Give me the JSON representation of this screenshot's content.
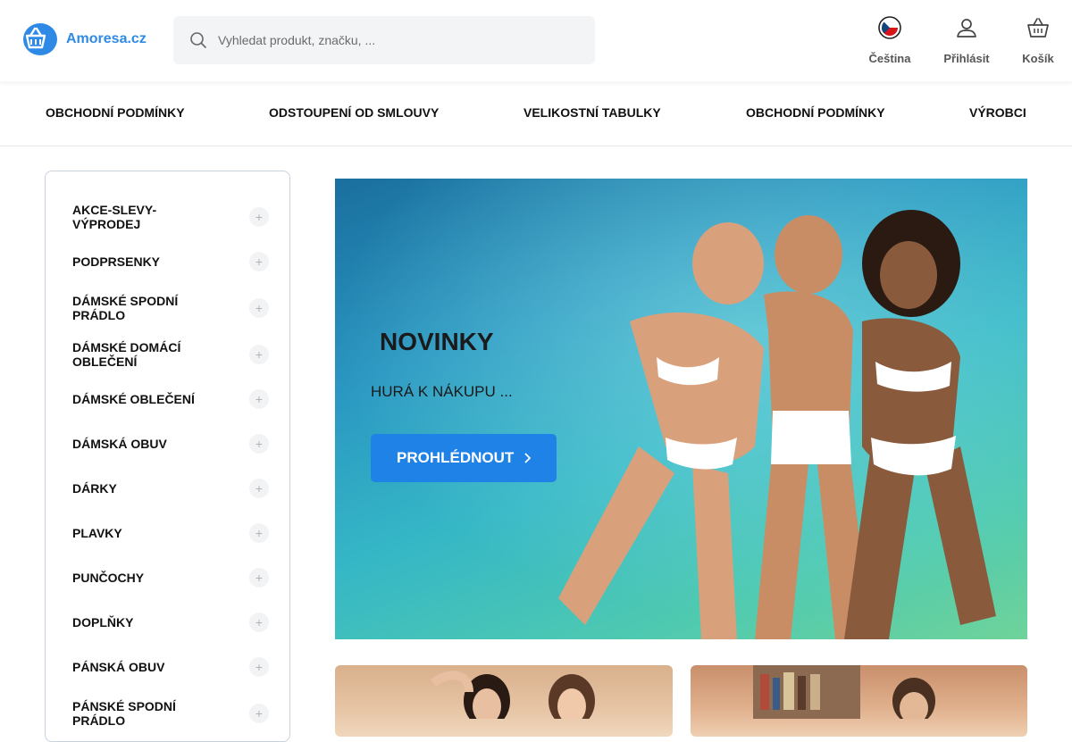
{
  "brand": {
    "name": "Amoresa.cz",
    "accent": "#2f8ae6"
  },
  "search": {
    "placeholder": "Vyhledat produkt, značku, ..."
  },
  "header_actions": {
    "language": {
      "label": "Čeština",
      "icon": "czech-flag-icon"
    },
    "login": {
      "label": "Přihlásit",
      "icon": "user-icon"
    },
    "cart": {
      "label": "Košík",
      "icon": "basket-icon"
    }
  },
  "nav": {
    "items": [
      {
        "label": "OBCHODNÍ PODMÍNKY"
      },
      {
        "label": "ODSTOUPENÍ OD SMLOUVY"
      },
      {
        "label": "VELIKOSTNÍ TABULKY"
      },
      {
        "label": "OBCHODNÍ PODMÍNKY"
      },
      {
        "label": "VÝROBCI"
      }
    ]
  },
  "sidebar": {
    "categories": [
      {
        "label": "AKCE-SLEVY-VÝPRODEJ"
      },
      {
        "label": "PODPRSENKY"
      },
      {
        "label": "DÁMSKÉ SPODNÍ PRÁDLO"
      },
      {
        "label": "DÁMSKÉ DOMÁCÍ OBLEČENÍ"
      },
      {
        "label": "DÁMSKÉ OBLEČENÍ"
      },
      {
        "label": "DÁMSKÁ OBUV"
      },
      {
        "label": "DÁRKY"
      },
      {
        "label": "PLAVKY"
      },
      {
        "label": "PUNČOCHY"
      },
      {
        "label": "DOPLŇKY"
      },
      {
        "label": "PÁNSKÁ OBUV"
      },
      {
        "label": "PÁNSKÉ SPODNÍ PRÁDLO"
      }
    ]
  },
  "hero": {
    "glyph": "",
    "title": "NOVINKY",
    "subtitle": "HURÁ K NÁKUPU ...",
    "button_label": "PROHLÉDNOUT",
    "button_color": "#1f82e6"
  }
}
